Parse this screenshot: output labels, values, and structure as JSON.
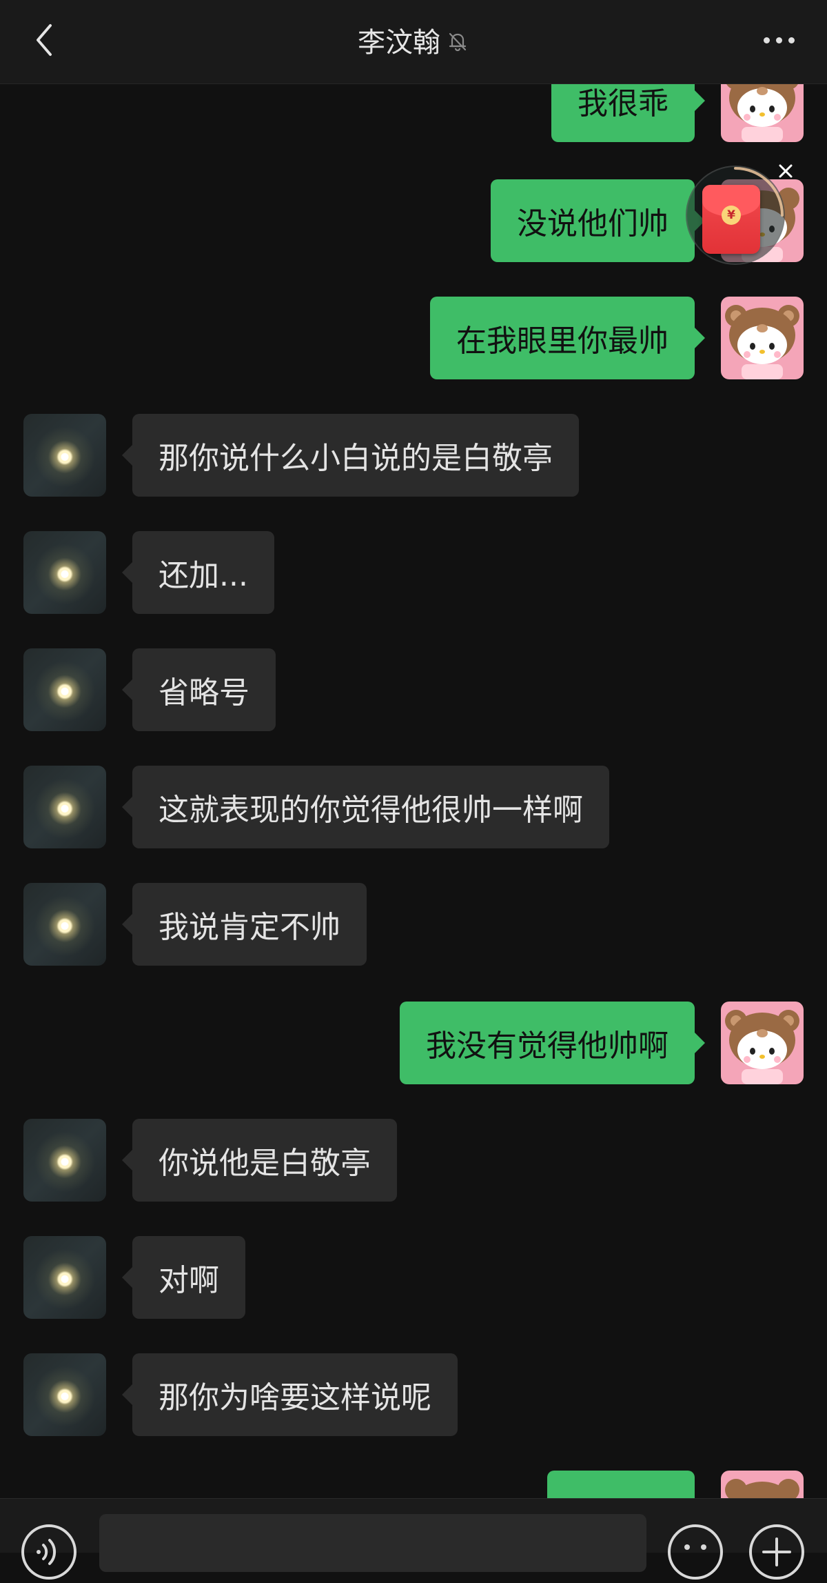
{
  "header": {
    "title": "李汶翰",
    "back_icon": "chevron-left-icon",
    "mute_icon": "bell-off-icon",
    "more_icon": "more-dots-icon"
  },
  "messages": [
    {
      "side": "out",
      "text": "我很乖"
    },
    {
      "side": "out",
      "text": "没说他们帅"
    },
    {
      "side": "out",
      "text": "在我眼里你最帅"
    },
    {
      "side": "in",
      "text": "那你说什么小白说的是白敬亭"
    },
    {
      "side": "in",
      "text": "还加..."
    },
    {
      "side": "in",
      "text": "省略号"
    },
    {
      "side": "in",
      "text": "这就表现的你觉得他很帅一样啊"
    },
    {
      "side": "in",
      "text": "我说肯定不帅"
    },
    {
      "side": "out",
      "text": "我没有觉得他帅啊"
    },
    {
      "side": "in",
      "text": "你说他是白敬亭"
    },
    {
      "side": "in",
      "text": "对啊"
    },
    {
      "side": "in",
      "text": "那你为啥要这样说呢"
    },
    {
      "side": "out",
      "text": ""
    }
  ],
  "floating_badge": {
    "icon": "red-packet-icon",
    "coin_symbol": "¥",
    "close_icon": "close-icon"
  },
  "input_bar": {
    "voice_icon": "voice-icon",
    "emoji_icon": "emoji-icon",
    "plus_icon": "plus-icon",
    "input_value": ""
  },
  "colors": {
    "background": "#111111",
    "outgoing_bubble": "#3fbd67",
    "incoming_bubble": "#2b2b2b",
    "red_packet": "#e23237"
  }
}
